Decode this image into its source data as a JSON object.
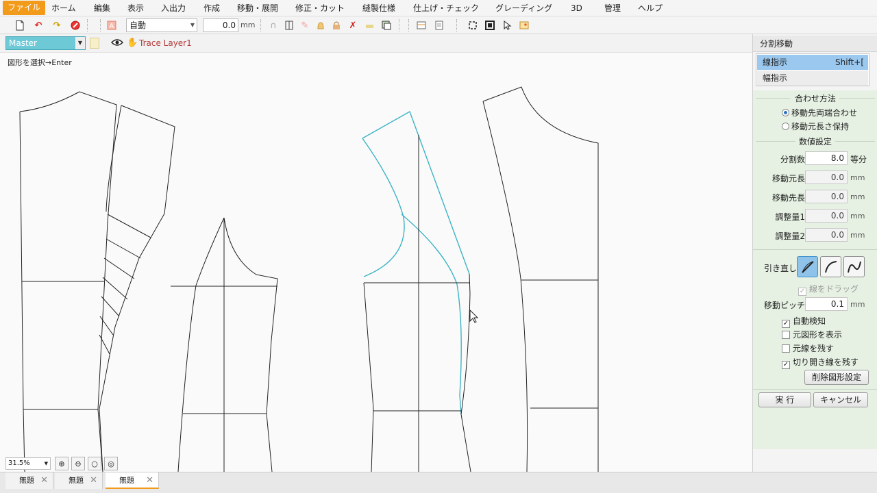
{
  "menu": {
    "items": [
      "ファイル",
      "ホーム",
      "編集",
      "表示",
      "入出力",
      "作成",
      "移動・展開",
      "修正・カット",
      "縫製仕様",
      "仕上げ・チェック",
      "グレーディング",
      "3D",
      "管理",
      "ヘルプ"
    ],
    "active_index": 0
  },
  "toolbar": {
    "mode_select": "自動",
    "value": "0.0",
    "unit": "mm"
  },
  "layer": {
    "select": "Master",
    "name": "Trace Layer1"
  },
  "canvas": {
    "hint": "図形を選択→Enter"
  },
  "zoom": {
    "level": "31.5%"
  },
  "tabs": [
    {
      "label": "無題",
      "active": false
    },
    {
      "label": "無題",
      "active": false
    },
    {
      "label": "無題",
      "active": true
    }
  ],
  "panel": {
    "title": "分割移動",
    "modes": [
      {
        "label": "線指示",
        "shortcut": "Shift+[",
        "selected": true
      },
      {
        "label": "幅指示",
        "shortcut": "",
        "selected": false
      }
    ],
    "align_title": "合わせ方法",
    "align_options": [
      {
        "label": "移動先両端合わせ",
        "checked": true
      },
      {
        "label": "移動元長さ保持",
        "checked": false
      }
    ],
    "num_title": "数値設定",
    "fields": [
      {
        "label": "分割数",
        "value": "8.0",
        "unit": "等分",
        "disabled": false
      },
      {
        "label": "移動元長",
        "value": "0.0",
        "unit": "mm",
        "disabled": true
      },
      {
        "label": "移動先長",
        "value": "0.0",
        "unit": "mm",
        "disabled": true
      },
      {
        "label": "調整量1",
        "value": "0.0",
        "unit": "mm",
        "disabled": true
      },
      {
        "label": "調整量2",
        "value": "0.0",
        "unit": "mm",
        "disabled": true
      }
    ],
    "redraw_label": "引き直し",
    "drag_label": "線をドラッグ",
    "pitch_label": "移動ピッチ",
    "pitch_value": "0.1",
    "pitch_unit": "mm",
    "checks": [
      {
        "label": "自動検知",
        "checked": true
      },
      {
        "label": "元図形を表示",
        "checked": false
      },
      {
        "label": "元線を残す",
        "checked": false
      },
      {
        "label": "切り開き線を残す",
        "checked": true
      }
    ],
    "delete_settings": "削除図形設定",
    "execute": "実 行",
    "cancel": "キャンセル"
  },
  "colors": {
    "accent": "#f29a1a",
    "selection_cyan": "#3bb4c4",
    "panel_green": "#e6f1e3"
  }
}
